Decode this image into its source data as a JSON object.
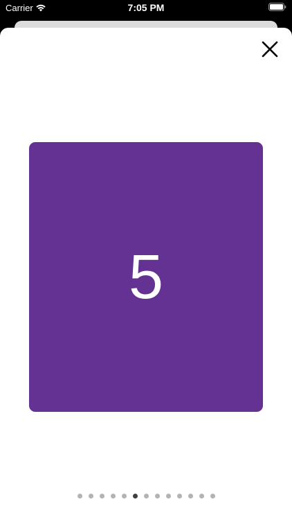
{
  "status_bar": {
    "carrier": "Carrier",
    "time": "7:05 PM",
    "wifi_icon": "wifi-icon",
    "battery_icon": "battery-icon"
  },
  "sheet": {
    "close_icon": "close-icon",
    "card": {
      "number": "5",
      "color": "#633292"
    },
    "page_control": {
      "count": 13,
      "current_index": 5,
      "active_color": "#404040",
      "inactive_color": "#b3b3b3"
    }
  }
}
